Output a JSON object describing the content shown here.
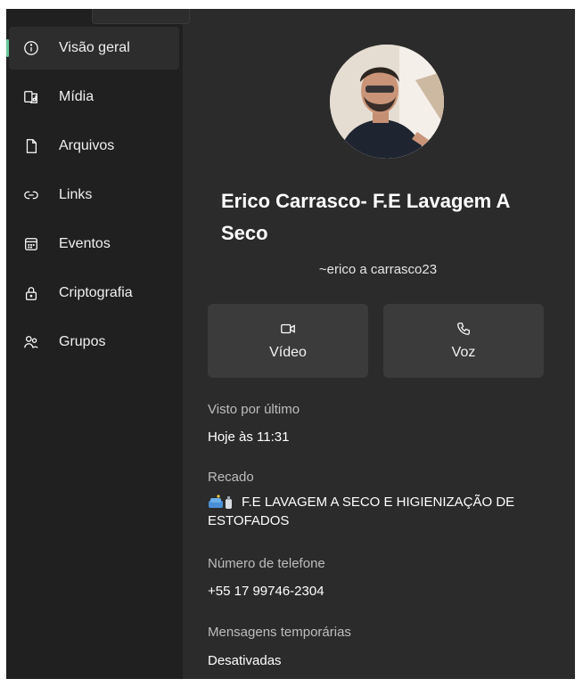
{
  "sidebar": {
    "items": [
      {
        "label": "Visão geral",
        "icon": "info-icon",
        "active": true
      },
      {
        "label": "Mídia",
        "icon": "media-icon",
        "active": false
      },
      {
        "label": "Arquivos",
        "icon": "file-icon",
        "active": false
      },
      {
        "label": "Links",
        "icon": "link-icon",
        "active": false
      },
      {
        "label": "Eventos",
        "icon": "calendar-icon",
        "active": false
      },
      {
        "label": "Criptografia",
        "icon": "lock-icon",
        "active": false
      },
      {
        "label": "Grupos",
        "icon": "people-icon",
        "active": false
      }
    ]
  },
  "profile": {
    "name": "Erico Carrasco- F.E Lavagem A Seco",
    "handle": "~erico a carrasco23"
  },
  "actions": {
    "video_label": "Vídeo",
    "voice_label": "Voz"
  },
  "info": {
    "last_seen_label": "Visto por último",
    "last_seen_value": "Hoje às 11:31",
    "about_label": "Recado",
    "about_value": "F.E LAVAGEM A SECO E HIGIENIZAÇÃO DE ESTOFADOS",
    "phone_label": "Número de telefone",
    "phone_value": "+55 17 99746-2304",
    "disappearing_label": "Mensagens temporárias",
    "disappearing_value": "Desativadas"
  },
  "colors": {
    "panel": "#2b2b2b",
    "sidebar": "#202020",
    "button": "#3b3b3b",
    "accent": "#67c79b"
  }
}
